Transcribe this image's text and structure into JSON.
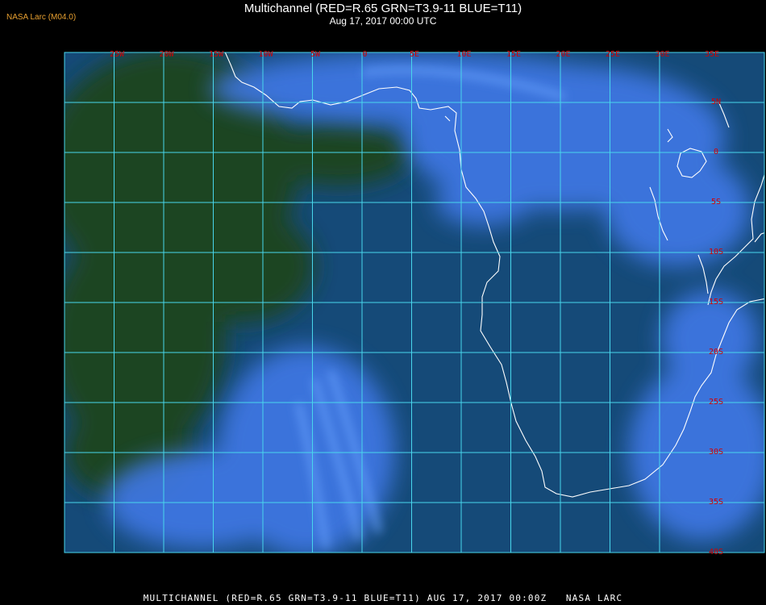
{
  "header": {
    "source": "NASA Larc (M04.0)",
    "title": "Multichannel (RED=R.65 GRN=T3.9-11 BLUE=T11)",
    "subtitle": "Aug 17, 2017 00:00 UTC"
  },
  "map": {
    "lon_labels": [
      "25W",
      "20W",
      "15W",
      "10W",
      "5W",
      "0",
      "5E",
      "10E",
      "15E",
      "20E",
      "25E",
      "30E",
      "35E"
    ],
    "lat_labels": [
      "5N",
      "0",
      "5S",
      "10S",
      "15S",
      "20S",
      "25S",
      "30S",
      "35S",
      "40S"
    ],
    "colors": {
      "ocean": "#154a78",
      "land": "#1d4424",
      "cloud": "#3f78e6",
      "grid": "#48d6ec",
      "coast": "#ffffff",
      "label": "#d40000"
    }
  },
  "footer": {
    "text": "MULTICHANNEL (RED=R.65 GRN=T3.9-11 BLUE=T11) AUG 17, 2017 00:00Z   NASA LARC"
  }
}
